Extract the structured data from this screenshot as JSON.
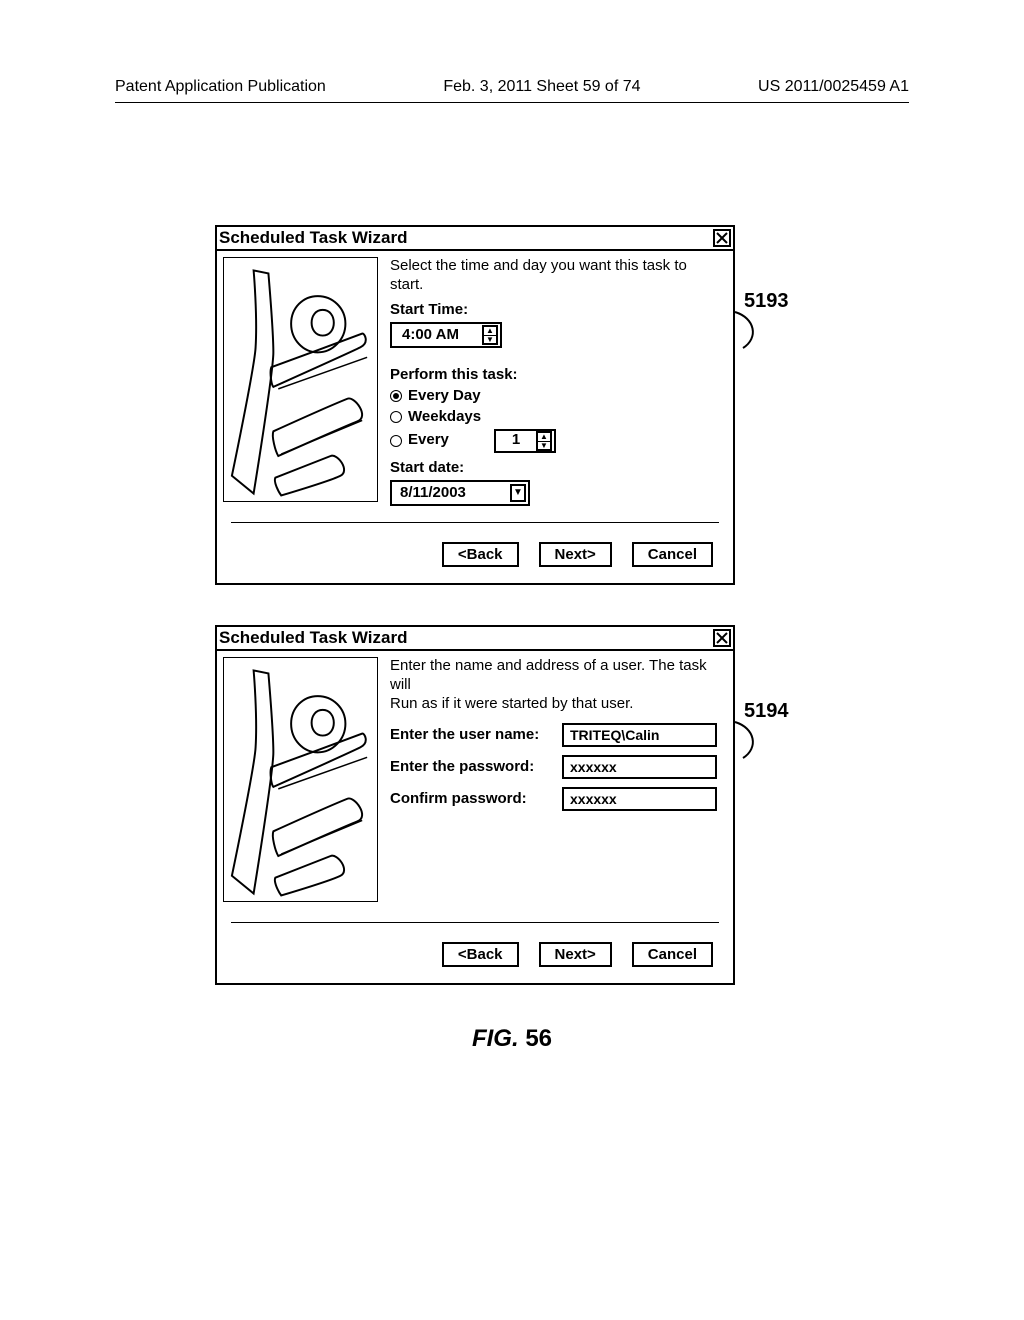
{
  "header": {
    "left": "Patent Application Publication",
    "center": "Feb. 3, 2011  Sheet 59 of 74",
    "right": "US 2011/0025459 A1"
  },
  "dialog1": {
    "title": "Scheduled Task Wizard",
    "instruction": "Select the time and day you want this task to start.",
    "start_time_label": "Start Time:",
    "start_time_value": "4:00 AM",
    "perform_label": "Perform this task:",
    "radio_everyday": "Every Day",
    "radio_weekdays": "Weekdays",
    "radio_every": "Every",
    "every_value": "1",
    "start_date_label": "Start date:",
    "start_date_value": "8/11/2003",
    "back": "<Back",
    "next": "Next>",
    "cancel": "Cancel",
    "ref": "5193"
  },
  "dialog2": {
    "title": "Scheduled Task Wizard",
    "instruction1": "Enter the name and address of a user. The task will",
    "instruction2": "Run as if it were started by that user.",
    "username_label": "Enter the user name:",
    "username_value": "TRITEQ\\Calin",
    "password_label": "Enter the password:",
    "password_value": "xxxxxx",
    "confirm_label": "Confirm password:",
    "confirm_value": "xxxxxx",
    "back": "<Back",
    "next": "Next>",
    "cancel": "Cancel",
    "ref": "5194"
  },
  "figure": {
    "prefix": "FIG.",
    "number": "56"
  }
}
